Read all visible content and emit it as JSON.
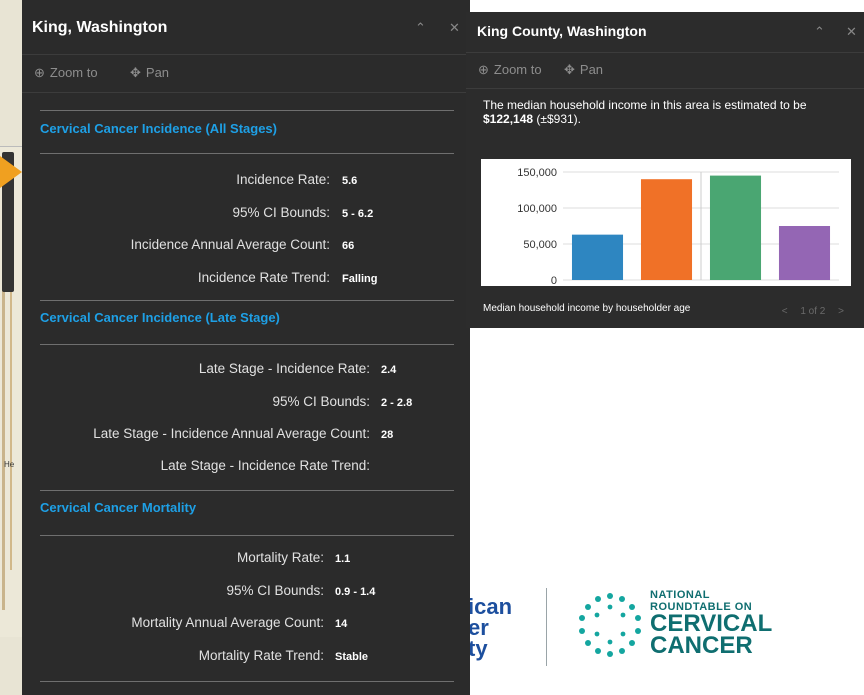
{
  "left_popup": {
    "title": "King, Washington",
    "zoom_label": "Zoom to",
    "pan_label": "Pan",
    "sections": [
      {
        "heading": "Cervical Cancer Incidence (All Stages)",
        "rows": [
          {
            "label": "Incidence Rate:",
            "value": "5.6"
          },
          {
            "label": "95% CI Bounds:",
            "value": "5 - 6.2"
          },
          {
            "label": "Incidence Annual Average Count:",
            "value": "66"
          },
          {
            "label": "Incidence Rate Trend:",
            "value": "Falling"
          }
        ]
      },
      {
        "heading": "Cervical Cancer Incidence (Late Stage)",
        "rows": [
          {
            "label": "Late Stage - Incidence Rate:",
            "value": "2.4"
          },
          {
            "label": "95% CI Bounds:",
            "value": "2 - 2.8"
          },
          {
            "label": "Late Stage - Incidence Annual Average Count:",
            "value": "28"
          },
          {
            "label": "Late Stage - Incidence Rate Trend:",
            "value": ""
          }
        ]
      },
      {
        "heading": "Cervical Cancer Mortality",
        "rows": [
          {
            "label": "Mortality Rate:",
            "value": "1.1"
          },
          {
            "label": "95% CI Bounds:",
            "value": "0.9 - 1.4"
          },
          {
            "label": "Mortality Annual Average Count:",
            "value": "14"
          },
          {
            "label": "Mortality Rate Trend:",
            "value": "Stable"
          }
        ]
      }
    ]
  },
  "right_popup": {
    "title": "King County, Washington",
    "zoom_label": "Zoom to",
    "pan_label": "Pan",
    "description_prefix": "The median household income in this area is estimated to be ",
    "description_value": "$122,148",
    "description_suffix": " (±$931).",
    "chart_caption": "Median household income by householder age",
    "pager": {
      "prev": "<",
      "text": "1 of 2",
      "next": ">"
    }
  },
  "header_icons": {
    "collapse": "chevron-up-icon",
    "close": "close-icon"
  },
  "map": {
    "label": "He"
  },
  "logos": {
    "left_lines": [
      "ican",
      "er",
      "ty"
    ],
    "right_small_1": "NATIONAL",
    "right_small_2": "ROUNDTABLE ON",
    "right_big_1": "CERVICAL",
    "right_big_2": "CANCER"
  },
  "colors": {
    "accent": "#1ea0e6",
    "panel": "#2b2b2b",
    "bar_colors": [
      "#2e86c1",
      "#f07127",
      "#4aa672",
      "#9466b4"
    ]
  },
  "chart_data": {
    "type": "bar",
    "categories": [
      "",
      "",
      "",
      ""
    ],
    "values": [
      63000,
      140000,
      145000,
      75000
    ],
    "ylim": [
      0,
      150000
    ],
    "yticks": [
      "0",
      "50,000",
      "100,000",
      "150,000"
    ],
    "ytick_values": [
      0,
      50000,
      100000,
      150000
    ],
    "grid": true,
    "title": "",
    "xlabel": "",
    "ylabel": ""
  }
}
